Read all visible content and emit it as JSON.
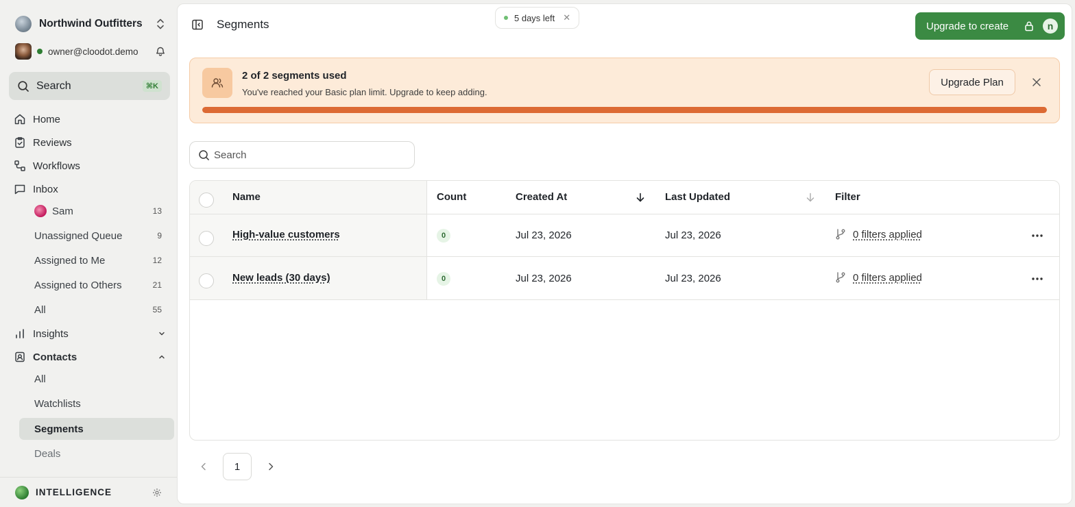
{
  "sidebar": {
    "org_name": "Northwind Outfitters",
    "user_email": "owner@cloodot.demo",
    "search_label": "Search",
    "search_shortcut": "⌘K",
    "nav": {
      "home": "Home",
      "reviews": "Reviews",
      "workflows": "Workflows",
      "inbox": "Inbox",
      "insights": "Insights",
      "contacts": "Contacts"
    },
    "inbox_items": [
      {
        "label": "Sam",
        "count": "13"
      },
      {
        "label": "Unassigned Queue",
        "count": "9"
      },
      {
        "label": "Assigned to Me",
        "count": "12"
      },
      {
        "label": "Assigned to Others",
        "count": "21"
      },
      {
        "label": "All",
        "count": "55"
      }
    ],
    "contacts_items": [
      "All",
      "Watchlists",
      "Segments",
      "Deals"
    ],
    "active_item": "Segments",
    "brand": "INTELLIGENCE"
  },
  "header": {
    "title": "Segments",
    "trial_text": "5 days left",
    "trial_close": "✕",
    "cta_label": "Upgrade to create",
    "cta_avatar_letter": "n"
  },
  "banner": {
    "title": "2 of 2 segments used",
    "text": "You've reached your Basic plan limit. Upgrade to keep adding.",
    "button": "Upgrade Plan",
    "progress_percent": 100,
    "bg_color": "#fdebd9",
    "bar_color": "#dc6a34"
  },
  "search": {
    "placeholder": "Search",
    "value": ""
  },
  "table": {
    "columns": {
      "name": "Name",
      "count": "Count",
      "created": "Created At",
      "updated": "Last Updated",
      "filter": "Filter"
    },
    "rows": [
      {
        "name": "High-value customers",
        "count": "0",
        "created": "Jul 23, 2026",
        "updated": "Jul 23, 2026",
        "filter": "0 filters applied"
      },
      {
        "name": "New leads (30 days)",
        "count": "0",
        "created": "Jul 23, 2026",
        "updated": "Jul 23, 2026",
        "filter": "0 filters applied"
      }
    ]
  },
  "pagination": {
    "current_page": "1"
  },
  "colors": {
    "accent": "#3b8a43",
    "sidebar_bg": "#f1f1ef"
  }
}
